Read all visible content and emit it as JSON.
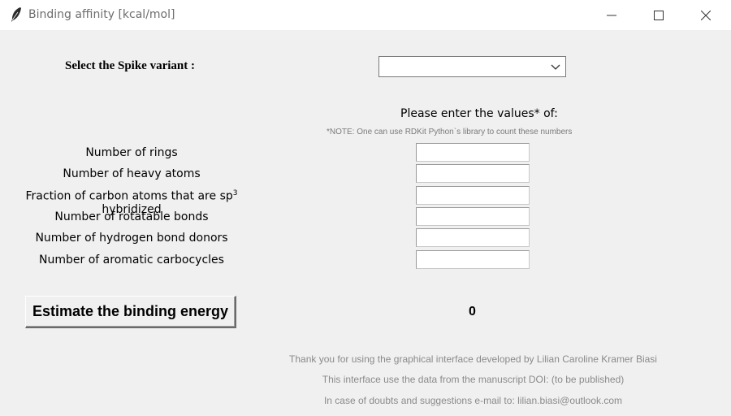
{
  "window": {
    "title": "Binding affinity [kcal/mol]",
    "icon": "feather-icon"
  },
  "spike": {
    "label": "Select the Spike variant :",
    "selected": ""
  },
  "values": {
    "heading": "Please enter the values* of:",
    "note": "*NOTE: One can use RDKit Python`s library to count these numbers"
  },
  "fields": [
    {
      "label": "Number of rings",
      "value": ""
    },
    {
      "label": "Number of heavy atoms",
      "value": ""
    },
    {
      "label_pre": "Fraction of carbon atoms that are sp",
      "label_sup": "3",
      "label_post": " hybridized",
      "value": ""
    },
    {
      "label": "Number of rotatable bonds",
      "value": ""
    },
    {
      "label": "Number of hydrogen bond donors",
      "value": ""
    },
    {
      "label": "Number of aromatic carbocycles",
      "value": ""
    }
  ],
  "action": {
    "button_label": "Estimate the binding energy",
    "result": "0"
  },
  "footer": {
    "line1": "Thank you for using the graphical interface developed by Lilian Caroline Kramer Biasi",
    "line2": "This interface use the data from the manuscript DOI: (to be published)",
    "line3": "In case of doubts and suggestions e-mail to: lilian.biasi@outlook.com"
  }
}
